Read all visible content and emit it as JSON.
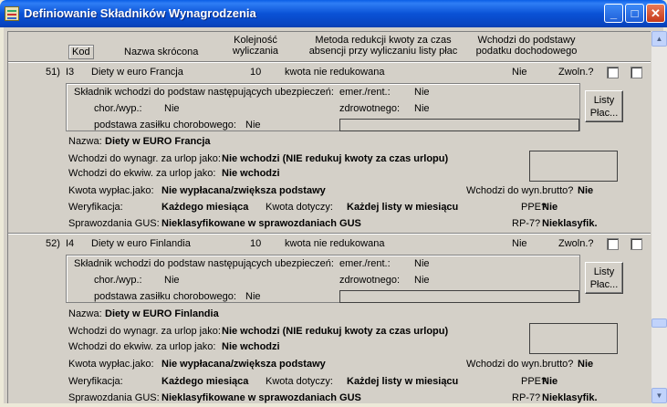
{
  "window": {
    "title": "Definiowanie Składników Wynagrodzenia",
    "minimize_glyph": "_",
    "maximize_glyph": "□",
    "close_glyph": "✕",
    "title_bar_color": "#0a52d6"
  },
  "header": {
    "kod": "Kod",
    "nazwa": "Nazwa skrócona",
    "kolejnosc_1": "Kolejność",
    "kolejnosc_2": "wyliczania",
    "metoda_1": "Metoda redukcji kwoty za czas",
    "metoda_2": "absencji przy wyliczaniu listy płac",
    "wchodzi_1": "Wchodzi do podstawy",
    "wchodzi_2": "podatku dochodowego"
  },
  "labels": {
    "skladnik": "Składnik wchodzi do podstaw następujących ubezpieczeń:",
    "emer": "emer./rent.:",
    "chor": "chor./wyp.:",
    "zdrowotnego": "zdrowotnego:",
    "zasilek": "podstawa zasiłku chorobowego:",
    "nazwa": "Nazwa:",
    "urlop": "Wchodzi do wynagr. za urlop jako:",
    "ekwiw": "Wchodzi do ekwiw. za urlop jako:",
    "kwota_wypl": "Kwota wypłac.jako:",
    "brutto": "Wchodzi do wyn.brutto?",
    "weryfikacja": "Weryfikacja:",
    "kwota_dotyczy": "Kwota dotyczy:",
    "ppe": "PPE?",
    "gus": "Sprawozdania GUS:",
    "rp7": "RP-7?",
    "zwoln": "Zwoln.?",
    "listy_1": "Listy",
    "listy_2": "Płac..."
  },
  "records": [
    {
      "num": "51)",
      "kod": "I3",
      "short_name": "Diety w euro Francja",
      "order": "10",
      "method": "kwota nie redukowana",
      "podatek": "Nie",
      "emer": "Nie",
      "chor": "Nie",
      "zdrow": "Nie",
      "zasilek": "Nie",
      "nazwa": "Diety w EURO Francja",
      "urlop": "Nie wchodzi  (NIE redukuj kwoty za czas urlopu)",
      "ekwiw": "Nie wchodzi",
      "kwota_wypl": "Nie wypłacana/zwiększa podstawy",
      "brutto": "Nie",
      "weryfikacja": "Każdego miesiąca",
      "kwota_dotyczy": "Każdej listy w miesiącu",
      "ppe": "Nie",
      "gus": "Nieklasyfikowane w sprawozdaniach GUS",
      "rp7": "Nieklasyfik."
    },
    {
      "num": "52)",
      "kod": "I4",
      "short_name": "Diety w euro Finlandia",
      "order": "10",
      "method": "kwota nie redukowana",
      "podatek": "Nie",
      "emer": "Nie",
      "chor": "Nie",
      "zdrow": "Nie",
      "zasilek": "Nie",
      "nazwa": "Diety w EURO Finlandia",
      "urlop": "Nie wchodzi  (NIE redukuj kwoty za czas urlopu)",
      "ekwiw": "Nie wchodzi",
      "kwota_wypl": "Nie wypłacana/zwiększa podstawy",
      "brutto": "Nie",
      "weryfikacja": "Każdego miesiąca",
      "kwota_dotyczy": "Każdej listy w miesiącu",
      "ppe": "Nie",
      "gus": "Nieklasyfikowane w sprawozdaniach GUS",
      "rp7": "Nieklasyfik."
    }
  ],
  "scrollbar": {
    "up_glyph": "▲",
    "down_glyph": "▼"
  }
}
